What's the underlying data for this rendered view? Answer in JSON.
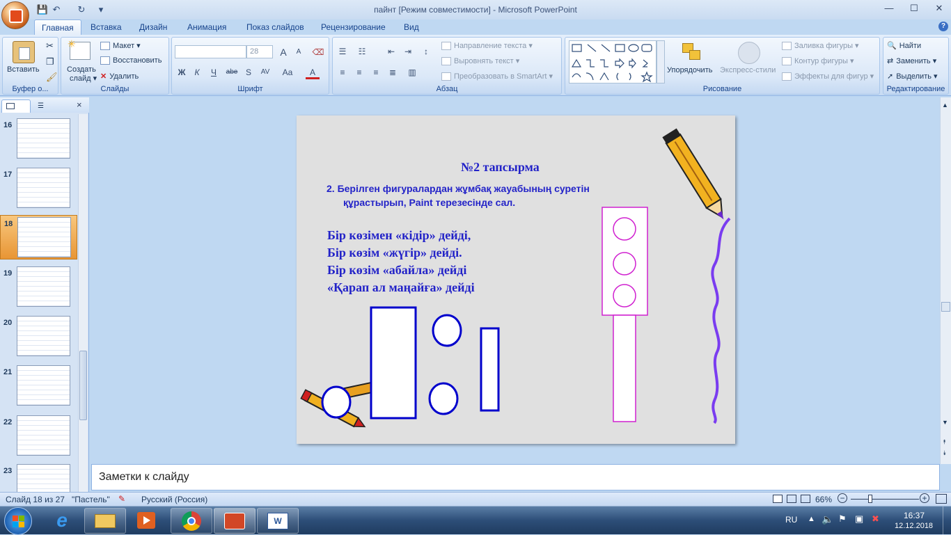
{
  "window": {
    "title": "пайнт [Режим совместимости] - Microsoft PowerPoint",
    "qa_save": "💾",
    "qa_undo": "↶",
    "qa_redo": "↻",
    "qa_more": "▾",
    "minimize": "—",
    "maximize": "☐",
    "close": "✕",
    "help": "?"
  },
  "tabs": [
    "Главная",
    "Вставка",
    "Дизайн",
    "Анимация",
    "Показ слайдов",
    "Рецензирование",
    "Вид"
  ],
  "ribbon": {
    "clipboard": {
      "paste": "Вставить",
      "label": "Буфер о..."
    },
    "slides": {
      "create": "Создать",
      "create2": "слайд ▾",
      "layout": "Макет ▾",
      "reset": "Восстановить",
      "delete": "Удалить",
      "label": "Слайды"
    },
    "font": {
      "size": "28",
      "label": "Шрифт",
      "b": "Ж",
      "i": "К",
      "u": "Ч",
      "s": "abe",
      "sh": "S",
      "sp": "AV",
      "case": "Aa",
      "col": "A",
      "grow": "A",
      "shrink": "A"
    },
    "paragraph": {
      "dir": "Направление текста ▾",
      "align": "Выровнять текст ▾",
      "smart": "Преобразовать в SmartArt ▾",
      "label": "Абзац"
    },
    "drawing": {
      "arrange": "Упорядочить",
      "quick": "Экспресс-стили",
      "fill": "Заливка фигуры ▾",
      "outline": "Контур фигуры ▾",
      "effects": "Эффекты для фигур ▾",
      "label": "Рисование"
    },
    "editing": {
      "find": "Найти",
      "replace": "Заменить ▾",
      "select": "Выделить ▾",
      "label": "Редактирование"
    }
  },
  "panel": {
    "close": "×",
    "thumbs": [
      "16",
      "17",
      "18",
      "19",
      "20",
      "21",
      "22",
      "23"
    ],
    "selected": "18"
  },
  "slide": {
    "title": "№2 тапсырма",
    "task_line1": "2. Берілген  фигуралардан  жұмбақ жауабының суретін",
    "task_line2": "құрастырып, Paint  терезесінде  сал.",
    "riddle": [
      "Бір көзімен «кідір» дейді,",
      "Бір көзім «жүгір» дейді.",
      "Бір көзім «абайла» дейді",
      "«Қарап ал маңайға» дейді"
    ]
  },
  "notes": "Заметки к слайду",
  "status": {
    "slide": "Слайд 18 из 27",
    "theme": "\"Пастель\"",
    "lang": "Русский (Россия)",
    "zoom": "66%",
    "minus": "−",
    "plus": "+"
  },
  "taskbar": {
    "lang": "RU",
    "time": "16:37",
    "date": "12.12.2018"
  },
  "colors": {
    "slide_text": "#2323c8",
    "magenta": "#d020d0",
    "blue_outline": "#0000cc",
    "accent": "#e28a3c"
  }
}
